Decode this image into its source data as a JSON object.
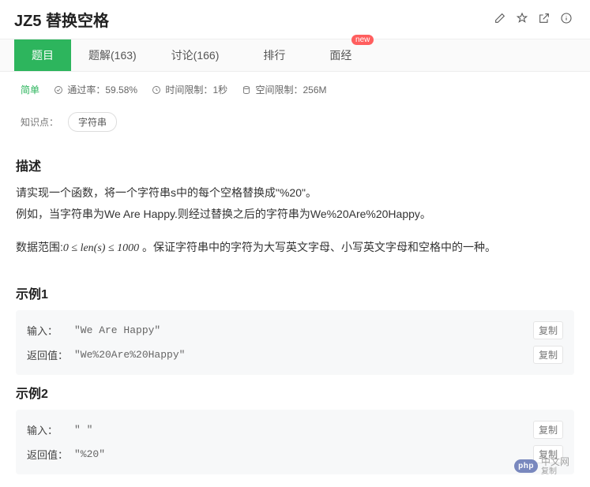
{
  "header": {
    "title": "JZ5 替换空格"
  },
  "tabs": {
    "problem": "题目",
    "solutions": "题解(163)",
    "discuss": "讨论(166)",
    "ranking": "排行",
    "interview": "面经",
    "new_badge": "new"
  },
  "meta": {
    "difficulty": "简单",
    "pass_rate_label": "通过率：",
    "pass_rate_value": "59.58%",
    "time_limit_label": "时间限制：",
    "time_limit_value": "1秒",
    "space_limit_label": "空间限制：",
    "space_limit_value": "256M"
  },
  "knowledge": {
    "label": "知识点：",
    "tag": "字符串"
  },
  "sections": {
    "desc_title": "描述",
    "desc_p1": "请实现一个函数，将一个字符串s中的每个空格替换成\"%20\"。",
    "desc_p2": "例如，当字符串为We Are Happy.则经过替换之后的字符串为We%20Are%20Happy。",
    "desc_p3_prefix": "数据范围:",
    "desc_p3_formula": "0 ≤ len(s) ≤ 1000",
    "desc_p3_suffix": " 。保证字符串中的字符为大写英文字母、小写英文字母和空格中的一种。"
  },
  "examples": [
    {
      "title": "示例1",
      "input_label": "输入：",
      "input_value": "\"We Are Happy\"",
      "output_label": "返回值：",
      "output_value": "\"We%20Are%20Happy\""
    },
    {
      "title": "示例2",
      "input_label": "输入：",
      "input_value": "\" \"",
      "output_label": "返回值：",
      "output_value": "\"%20\""
    }
  ],
  "copy_label": "复制",
  "watermark": {
    "badge": "php",
    "text": "中文网",
    "sub": "复制"
  }
}
